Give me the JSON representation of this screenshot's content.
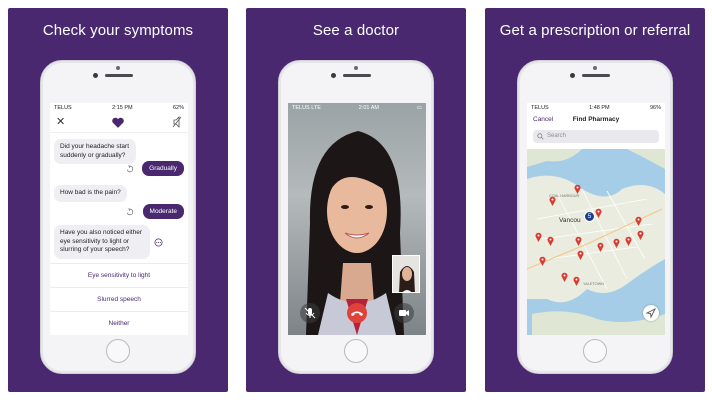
{
  "panels": [
    {
      "title": "Check your symptoms"
    },
    {
      "title": "See a doctor"
    },
    {
      "title": "Get a prescription or referral"
    }
  ],
  "chat_screen": {
    "status": {
      "carrier": "TELUS",
      "time": "2:15 PM",
      "battery": "62%"
    },
    "messages": [
      {
        "from": "bot",
        "text": "Did your headache start suddenly or gradually?"
      },
      {
        "from": "user",
        "text": "Gradually"
      },
      {
        "from": "bot",
        "text": "How bad is the pain?"
      },
      {
        "from": "user",
        "text": "Moderate"
      },
      {
        "from": "bot",
        "text": "Have you also noticed either eye sensitivity to light or slurring of your speech?"
      }
    ],
    "options": [
      "Eye sensitivity to light",
      "Slurred speech",
      "Neither"
    ]
  },
  "video_screen": {
    "status": {
      "carrier": "TELUS",
      "network": "LTE",
      "time": "2:01 AM"
    }
  },
  "map_screen": {
    "status": {
      "carrier": "TELUS",
      "time": "1:48 PM",
      "battery": "96%"
    },
    "cancel_label": "Cancel",
    "nav_title": "Find Pharmacy",
    "search_placeholder": "Search",
    "city_label": "Vancou",
    "harbour_label": "COAL HARBOUR",
    "yaletown_label": "YALETOWN",
    "cluster_count": "5"
  },
  "colors": {
    "brand_purple": "#4a2870",
    "end_call_red": "#e0413b",
    "map_water": "#a6cde8",
    "map_land": "#e9ecdf",
    "pin_red": "#d63c32"
  }
}
